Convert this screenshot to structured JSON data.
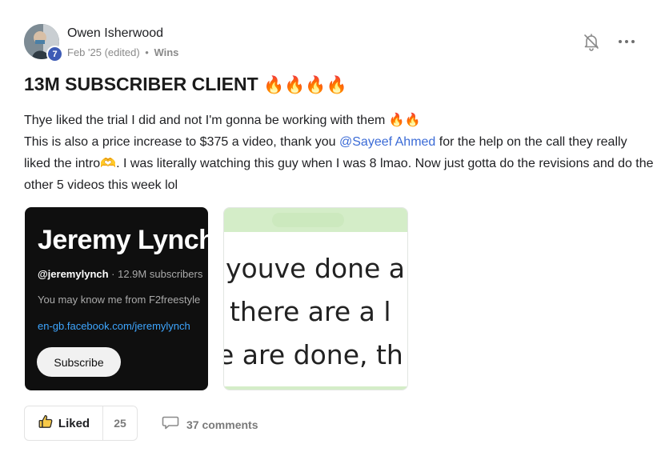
{
  "author": {
    "name": "Owen Isherwood",
    "level": "7",
    "date": "Feb '25 (edited)",
    "separator": "•",
    "category": "Wins"
  },
  "post": {
    "title": "13M SUBSCRIBER CLIENT",
    "title_emoji": "🔥🔥🔥🔥",
    "line1": "Thye liked the trial I did and not I'm gonna be working with them",
    "line1_emoji": "🔥🔥",
    "line2_before": "This is also a price increase to $375 a video, thank you ",
    "mention": "@Sayeef Ahmed",
    "line2_after": " for the help on the call they really liked the intro",
    "hands_emoji": "🫶",
    "line2_end": ". I was literally watching this guy when I was 8 lmao. Now just gotta do the revisions and do the other 5 videos this week lol"
  },
  "attachments": {
    "youtube": {
      "channel_name": "Jeremy Lynch",
      "handle": "@jeremylynch",
      "stats": " · 12.9M subscribers",
      "bio": "You may know me from F2freestyle",
      "link": "en-gb.facebook.com/jeremylynch",
      "subscribe_label": "Subscribe"
    },
    "chat_crop": {
      "line1": "youve done a",
      "line2": ", there are a l",
      "line3": "e are done, th"
    }
  },
  "footer": {
    "like_label": "Liked",
    "like_count": "25",
    "comments_label": "37 comments"
  },
  "icons": {
    "bell": "bell-off-icon",
    "more": "more-dots-icon",
    "thumb": "thumbs-up-icon",
    "comment": "comment-bubble-icon"
  },
  "colors": {
    "level_badge": "#3d5bb5",
    "mention": "#3b6bd6",
    "youtube_link": "#3ea6ff",
    "chat_green": "#d4edc8"
  }
}
